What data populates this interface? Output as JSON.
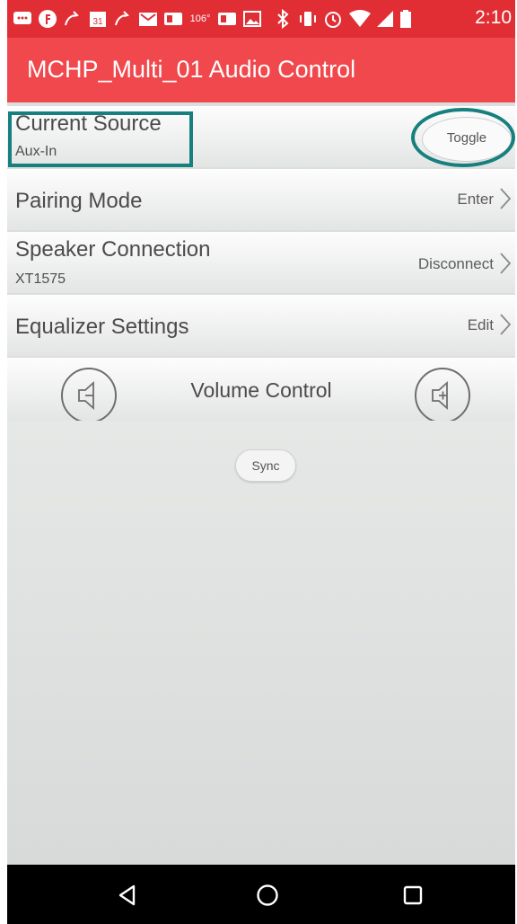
{
  "status_bar": {
    "time": "2:10",
    "icons": [
      "messaging-icon",
      "app-icon",
      "missed-call-icon",
      "calendar-icon",
      "missed-call-icon",
      "gmail-icon",
      "app-icon",
      "weather-icon",
      "app-icon",
      "image-icon",
      "bluetooth-icon",
      "vibrate-icon",
      "alarm-icon",
      "wifi-icon",
      "signal-icon",
      "battery-icon"
    ],
    "calendar_day": "31",
    "temperature": "106°"
  },
  "app_bar": {
    "title": "MCHP_Multi_01 Audio Control"
  },
  "rows": {
    "current_source": {
      "title": "Current Source",
      "subtitle": "Aux-In",
      "action": "Toggle"
    },
    "pairing_mode": {
      "title": "Pairing Mode",
      "action": "Enter"
    },
    "speaker_connection": {
      "title": "Speaker Connection",
      "subtitle": "XT1575",
      "action": "Disconnect"
    },
    "equalizer_settings": {
      "title": "Equalizer Settings",
      "action": "Edit"
    }
  },
  "volume": {
    "label": "Volume Control",
    "down_icon": "volume-down-icon",
    "up_icon": "volume-up-icon"
  },
  "sync": {
    "label": "Sync"
  },
  "nav_bar": {
    "icons": [
      "back-icon",
      "home-icon",
      "recents-icon"
    ]
  },
  "colors": {
    "status_bar": "#e12e35",
    "app_bar": "#f0484c",
    "highlight": "#17807f",
    "background": "#dcdedd"
  }
}
